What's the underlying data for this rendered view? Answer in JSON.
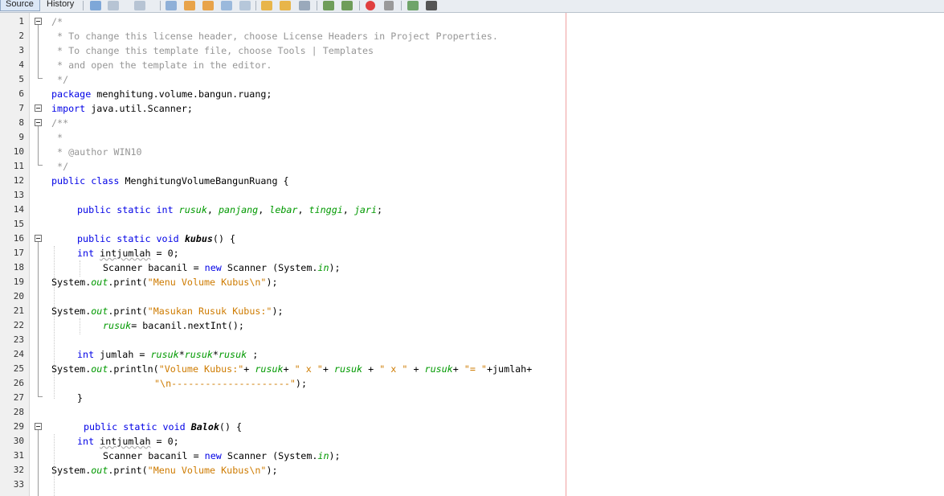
{
  "tabs": {
    "source": "Source",
    "history": "History"
  },
  "toolbar": {
    "buttons": [
      "last-edit-icon",
      "back-icon",
      "forward-icon",
      "find-icon",
      "find-previous-icon",
      "find-next-icon",
      "find-selection-icon",
      "toggle-highlight-icon",
      "shift-left-icon",
      "shift-right-icon",
      "toggle-bookmark-icon",
      "previous-bookmark-icon",
      "next-bookmark-icon",
      "start-macro-icon",
      "stop-macro-icon",
      "comment-icon",
      "uncomment-icon"
    ]
  },
  "lines": {
    "l1": "/*",
    "l2": " * To change this license header, choose License Headers in Project Properties.",
    "l3": " * To change this template file, choose Tools | Templates",
    "l4": " * and open the template in the editor.",
    "l5": " */",
    "l6a": "package",
    "l6b": " menghitung.volume.bangun.ruang;",
    "l7a": "import",
    "l7b": " java.util.Scanner;",
    "l8": "/**",
    "l9": " *",
    "l10": " * @author WIN10",
    "l11": " */",
    "l12a": "public class",
    "l12b": " MenghitungVolumeBangunRuang {",
    "l14a": "public static int",
    "l14f1": "rusuk",
    "l14f2": "panjang",
    "l14f3": "lebar",
    "l14f4": "tinggi",
    "l14f5": "jari",
    "l16a": "public static void",
    "l16m": "kubus",
    "l16b": "() {",
    "l17a": "int",
    "l17v": "intjumlah",
    "l17b": " = 0;",
    "l18a": "Scanner bacanil = ",
    "l18k": "new",
    "l18b": " Scanner (System.",
    "l18s": "in",
    "l18c": ");",
    "l19a": "System.",
    "l19s": "out",
    "l19b": ".print(",
    "l19str": "\"Menu Volume Kubus\\n\"",
    "l19c": ");",
    "l21str": "\"Masukan Rusuk Kubus:\"",
    "l22f": "rusuk",
    "l22b": "= bacanil.nextInt();",
    "l24a": "int",
    "l24b": " jumlah = ",
    "l25b": ".println(",
    "l25s1": "\"Volume Kubus:\"",
    "l25s2": "\" x \"",
    "l25s4": "\"= \"",
    "l25c": "+jumlah+",
    "l26str": "\"\\n---------------------\"",
    "l26c": ");",
    "l27": "}",
    "l29m": "Balok"
  },
  "line_numbers": [
    "1",
    "2",
    "3",
    "4",
    "5",
    "6",
    "7",
    "8",
    "9",
    "10",
    "11",
    "12",
    "13",
    "14",
    "15",
    "16",
    "17",
    "18",
    "19",
    "20",
    "21",
    "22",
    "23",
    "24",
    "25",
    "26",
    "27",
    "28",
    "29",
    "30",
    "31",
    "32",
    "33"
  ]
}
